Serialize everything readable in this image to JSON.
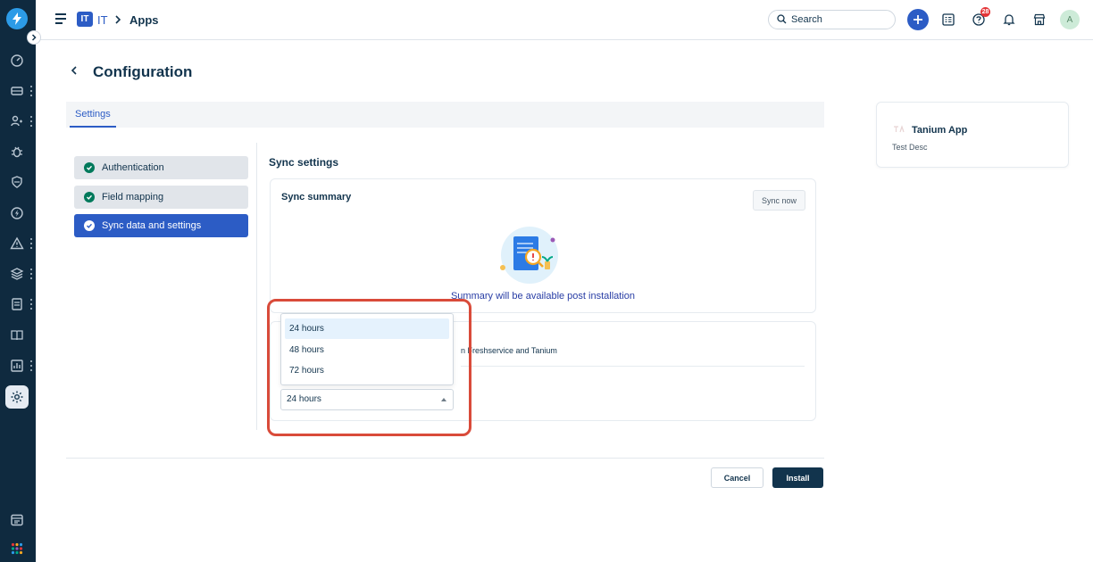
{
  "header": {
    "workspace_badge": "IT",
    "workspace_name": "IT",
    "separator": ">",
    "page": "Apps",
    "search_placeholder": "Search",
    "notification_count": "28",
    "avatar_initial": "A"
  },
  "page": {
    "back_symbol": "<",
    "title": "Configuration",
    "tabs": [
      {
        "label": "Settings",
        "active": true
      }
    ]
  },
  "steps": [
    {
      "label": "Authentication",
      "status": "completed"
    },
    {
      "label": "Field mapping",
      "status": "completed"
    },
    {
      "label": "Sync data and settings",
      "status": "active"
    }
  ],
  "sync": {
    "title": "Sync settings",
    "summary_title": "Sync summary",
    "sync_now_label": "Sync now",
    "summary_message": "Summary will be available post installation",
    "partial_text": "n Freshservice and Tanium",
    "interval_options": [
      "24 hours",
      "48 hours",
      "72 hours"
    ],
    "highlighted_option": "24 hours",
    "interval_value": "24 hours"
  },
  "footer": {
    "cancel_label": "Cancel",
    "install_label": "Install"
  },
  "app": {
    "name": "Tanium App",
    "description": "Test Desc"
  },
  "colors": {
    "sidebar": "#0f2a3f",
    "accent": "#2c5cc5",
    "success": "#00795b",
    "primary_button": "#12344d",
    "highlight_box": "#d94b3a",
    "badge": "#e43538"
  }
}
